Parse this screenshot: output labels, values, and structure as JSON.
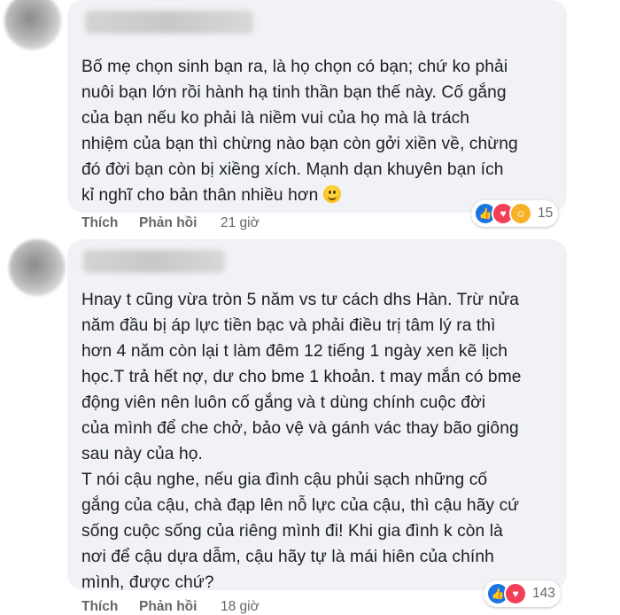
{
  "comments": [
    {
      "lines": [
        "Bố mẹ chọn sinh bạn ra, là họ chọn có bạn; chứ ko phải",
        "nuôi bạn lớn rồi hành hạ tinh thần bạn thế này. Cố gắng",
        "của bạn nếu ko phải là niềm vui của họ mà là trách",
        "nhiệm của bạn thì chừng nào bạn còn gởi xiền về, chừng",
        "đó đời bạn còn bị xiềng xích. Mạnh dạn khuyên bạn ích",
        "kỉ nghĩ cho bản thân nhiều hơn"
      ],
      "like_label": "Thích",
      "reply_label": "Phản hồi",
      "time": "21 giờ",
      "reaction_count": "15",
      "reactions": [
        "like",
        "love",
        "care"
      ]
    },
    {
      "lines": [
        "Hnay t cũng vừa tròn 5 năm vs tư cách dhs Hàn. Trừ nửa",
        "năm đầu bị áp lực tiền bạc và phải điều trị tâm lý ra thì",
        "hơn 4 năm còn lại t làm đêm 12 tiếng 1 ngày xen kẽ lịch",
        "học.T trả hết nợ, dư cho bme 1 khoản. t may mắn có bme",
        "động viên nên luôn cố gắng và t dùng chính cuộc đời",
        "của mình để che chở, bảo vệ và gánh vác thay bão giông",
        "sau này của họ.",
        "T nói cậu nghe, nếu gia đình cậu phủi sạch những cố",
        "gắng của cậu, chà đạp lên nỗ lực của cậu, thì cậu hãy cứ",
        "sống cuộc sống của riêng mình đi! Khi gia đình k còn là",
        "nơi để cậu dựa dẫm, cậu hãy tự là mái hiên của chính",
        "mình, được chứ?"
      ],
      "like_label": "Thích",
      "reply_label": "Phản hồi",
      "time": "18 giờ",
      "reaction_count": "143",
      "reactions": [
        "like",
        "love"
      ]
    }
  ]
}
